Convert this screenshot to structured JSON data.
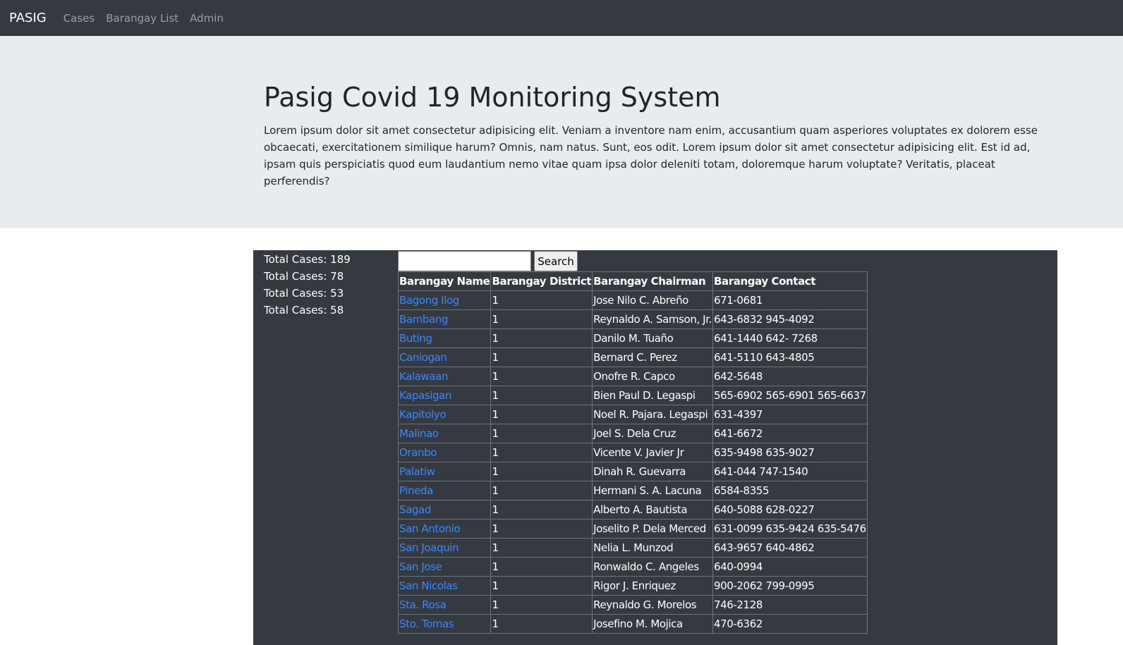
{
  "nav": {
    "brand": "PASIG",
    "links": [
      "Cases",
      "Barangay List",
      "Admin"
    ]
  },
  "hero": {
    "title": "Pasig Covid 19 Monitoring System",
    "lead": "Lorem ipsum dolor sit amet consectetur adipisicing elit. Veniam a inventore nam enim, accusantium quam asperiores voluptates ex dolorem esse obcaecati, exercitationem similique harum? Omnis, nam natus. Sunt, eos odit. Lorem ipsum dolor sit amet consectetur adipisicing elit. Est id ad, ipsam quis perspiciatis quod eum laudantium nemo vitae quam ipsa dolor deleniti totam, doloremque harum voluptate? Veritatis, placeat perferendis?"
  },
  "totals": [
    "Total Cases: 189",
    "Total Cases: 78",
    "Total Cases: 53",
    "Total Cases: 58"
  ],
  "search": {
    "value": "",
    "button_label": "Search"
  },
  "table": {
    "headers": [
      "Barangay Name",
      "Barangay District",
      "Barangay Chairman",
      "Barangay Contact"
    ],
    "rows": [
      [
        "Bagong Ilog",
        "1",
        "Jose Nilo C. Abreño",
        "671-0681"
      ],
      [
        "Bambang",
        "1",
        "Reynaldo A. Samson, Jr.",
        "643-6832 945-4092"
      ],
      [
        "Buting",
        "1",
        "Danilo M. Tuaño",
        "641-1440 642- 7268"
      ],
      [
        "Caniogan",
        "1",
        "Bernard C. Perez",
        "641-5110 643-4805"
      ],
      [
        "Kalawaan",
        "1",
        "Onofre R. Capco",
        "642-5648"
      ],
      [
        "Kapasigan",
        "1",
        "Bien Paul D. Legaspi",
        "565-6902 565-6901 565-6637"
      ],
      [
        "Kapitolyo",
        "1",
        "Noel R. Pajara. Legaspi",
        "631-4397"
      ],
      [
        "Malinao",
        "1",
        "Joel S. Dela Cruz",
        "641-6672"
      ],
      [
        "Oranbo",
        "1",
        "Vicente V. Javier Jr",
        "635-9498 635-9027"
      ],
      [
        "Palatiw",
        "1",
        "Dinah R. Guevarra",
        "641-044 747-1540"
      ],
      [
        "Pineda",
        "1",
        "Hermani S. A. Lacuna",
        "6584-8355"
      ],
      [
        "Sagad",
        "1",
        "Alberto A. Bautista",
        "640-5088 628-0227"
      ],
      [
        "San Antonio",
        "1",
        "Joselito P. Dela Merced",
        "631-0099 635-9424 635-5476"
      ],
      [
        "San Joaquin",
        "1",
        "Nelia L. Munzod",
        "643-9657 640-4862"
      ],
      [
        "San Jose",
        "1",
        "Ronwaldo C. Angeles",
        "640-0994"
      ],
      [
        "San Nicolas",
        "1",
        "Rigor J. Enriquez",
        "900-2062 799-0995"
      ],
      [
        "Sta. Rosa",
        "1",
        "Reynaldo G. Morelos",
        "746-2128"
      ],
      [
        "Sto. Tomas",
        "1",
        "Josefino M. Mojica",
        "470-6362"
      ]
    ]
  },
  "colors": {
    "navbar": "#343a40",
    "jumbotron": "#e9ecef",
    "link": "#3b86ff"
  }
}
